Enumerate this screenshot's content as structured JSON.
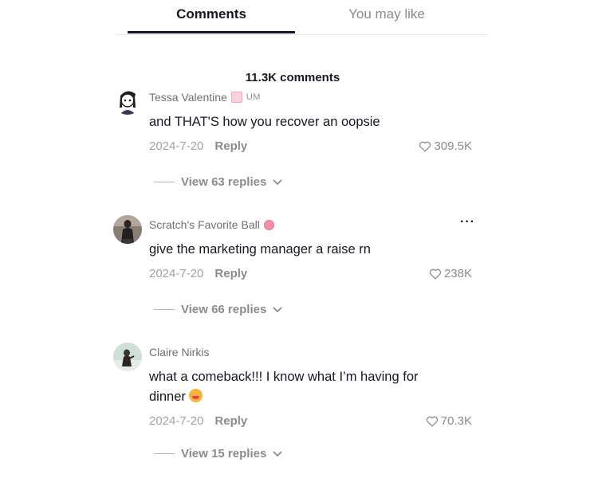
{
  "tabs": {
    "comments": "Comments",
    "you_may_like": "You may like"
  },
  "comment_count": "11.3K comments",
  "comments": [
    {
      "username": "Tessa Valentine",
      "badge": "UM",
      "text": "and THAT'S how you recover an oopsie",
      "date": "2024-7-20",
      "reply": "Reply",
      "likes": "309.5K",
      "view_replies": "View 63 replies"
    },
    {
      "username": "Scratch's Favorite Ball",
      "text": "give the marketing manager a raise rn",
      "date": "2024-7-20",
      "reply": "Reply",
      "likes": "238K",
      "more": "···",
      "view_replies": "View 66 replies"
    },
    {
      "username": "Claire Nirkis",
      "text_line1": "what a comeback!!! I know what I’m having for",
      "text_line2": "dinner",
      "emoji": "yum-emoji",
      "date": "2024-7-20",
      "reply": "Reply",
      "likes": "70.3K",
      "view_replies": "View 15 replies"
    }
  ],
  "colors": {
    "primary_text": "#161823",
    "secondary_text": "#8a8b91",
    "tab_underline": "#161823"
  }
}
